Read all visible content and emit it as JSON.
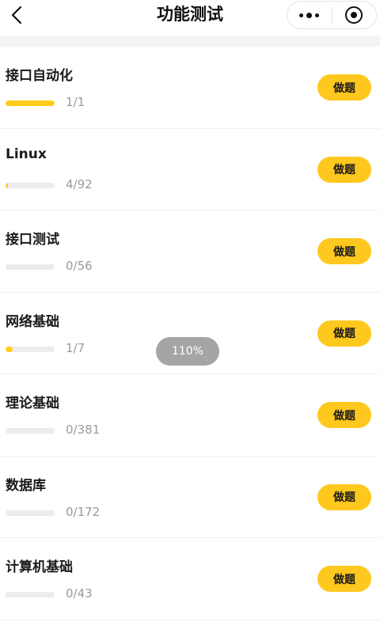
{
  "header": {
    "title": "功能测试",
    "back_icon": "chevron-left-icon",
    "more_icon": "more-dots-icon",
    "close_icon": "target-icon"
  },
  "categories": [
    {
      "name": "接口自动化",
      "progress_text": "1/1",
      "progress": 1.0,
      "button": "做题"
    },
    {
      "name": "Linux",
      "progress_text": "4/92",
      "progress": 0.043,
      "button": "做题"
    },
    {
      "name": "接口测试",
      "progress_text": "0/56",
      "progress": 0.0,
      "button": "做题"
    },
    {
      "name": "网络基础",
      "progress_text": "1/7",
      "progress": 0.143,
      "button": "做题"
    },
    {
      "name": "理论基础",
      "progress_text": "0/381",
      "progress": 0.0,
      "button": "做题"
    },
    {
      "name": "数据库",
      "progress_text": "0/172",
      "progress": 0.0,
      "button": "做题"
    },
    {
      "name": "计算机基础",
      "progress_text": "0/43",
      "progress": 0.0,
      "button": "做题"
    }
  ],
  "zoom_toast": "110%",
  "colors": {
    "accent": "#ffc81e",
    "progress_fill": "#ffcc1a",
    "progress_track": "#ececec",
    "secondary_text": "#9a9a9a"
  }
}
